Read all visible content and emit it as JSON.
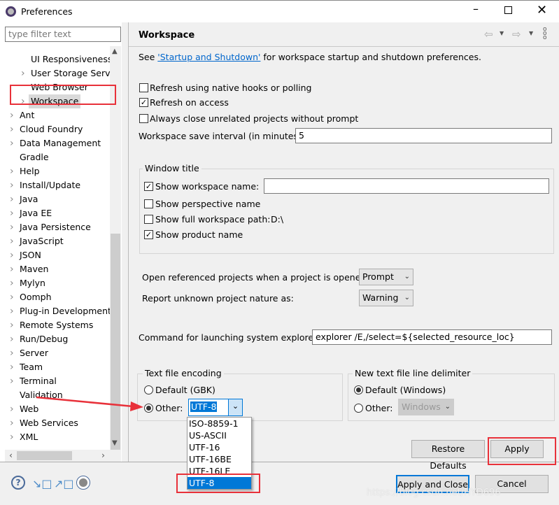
{
  "window": {
    "title": "Preferences"
  },
  "filter": {
    "placeholder": "type filter text"
  },
  "tree": [
    {
      "label": "UI Responsiveness",
      "level": 2,
      "expandable": false
    },
    {
      "label": "User Storage Servic",
      "level": 2,
      "expandable": true
    },
    {
      "label": "Web Browser",
      "level": 2,
      "expandable": false
    },
    {
      "label": "Workspace",
      "level": 2,
      "expandable": true,
      "selected": true
    },
    {
      "label": "Ant",
      "level": 1,
      "expandable": true
    },
    {
      "label": "Cloud Foundry",
      "level": 1,
      "expandable": true
    },
    {
      "label": "Data Management",
      "level": 1,
      "expandable": true
    },
    {
      "label": "Gradle",
      "level": 1,
      "expandable": false
    },
    {
      "label": "Help",
      "level": 1,
      "expandable": true
    },
    {
      "label": "Install/Update",
      "level": 1,
      "expandable": true
    },
    {
      "label": "Java",
      "level": 1,
      "expandable": true
    },
    {
      "label": "Java EE",
      "level": 1,
      "expandable": true
    },
    {
      "label": "Java Persistence",
      "level": 1,
      "expandable": true
    },
    {
      "label": "JavaScript",
      "level": 1,
      "expandable": true
    },
    {
      "label": "JSON",
      "level": 1,
      "expandable": true
    },
    {
      "label": "Maven",
      "level": 1,
      "expandable": true
    },
    {
      "label": "Mylyn",
      "level": 1,
      "expandable": true
    },
    {
      "label": "Oomph",
      "level": 1,
      "expandable": true
    },
    {
      "label": "Plug-in Development",
      "level": 1,
      "expandable": true
    },
    {
      "label": "Remote Systems",
      "level": 1,
      "expandable": true
    },
    {
      "label": "Run/Debug",
      "level": 1,
      "expandable": true
    },
    {
      "label": "Server",
      "level": 1,
      "expandable": true
    },
    {
      "label": "Team",
      "level": 1,
      "expandable": true
    },
    {
      "label": "Terminal",
      "level": 1,
      "expandable": true
    },
    {
      "label": "Validation",
      "level": 1,
      "expandable": false
    },
    {
      "label": "Web",
      "level": 1,
      "expandable": true
    },
    {
      "label": "Web Services",
      "level": 1,
      "expandable": true
    },
    {
      "label": "XML",
      "level": 1,
      "expandable": true
    }
  ],
  "page": {
    "title": "Workspace",
    "see_prefix": "See ",
    "see_link": "'Startup and Shutdown'",
    "see_suffix": " for workspace startup and shutdown preferences.",
    "refresh_native": {
      "label": "Refresh using native hooks or polling",
      "checked": false
    },
    "refresh_access": {
      "label": "Refresh on access",
      "checked": true
    },
    "always_close": {
      "label": "Always close unrelated projects without prompt",
      "checked": false
    },
    "save_interval": {
      "label": "Workspace save interval (in minutes):",
      "value": "5"
    },
    "window_title": {
      "group": "Window title",
      "show_ws_name": {
        "label": "Show workspace name:",
        "checked": true,
        "value": ""
      },
      "show_perspective": {
        "label": "Show perspective name",
        "checked": false
      },
      "show_full_path": {
        "label": "Show full workspace path:",
        "checked": false,
        "value": "D:\\"
      },
      "show_product": {
        "label": "Show product name",
        "checked": true
      }
    },
    "open_ref": {
      "label": "Open referenced projects when a project is opened:",
      "value": "Prompt"
    },
    "report_unknown": {
      "label": "Report unknown project nature as:",
      "value": "Warning"
    },
    "explorer_cmd": {
      "label": "Command for launching system explorer:",
      "value": "explorer /E,/select=${selected_resource_loc}"
    },
    "encoding": {
      "group": "Text file encoding",
      "default_label": "Default (GBK)",
      "other_label": "Other:",
      "value": "UTF-8",
      "options": [
        "ISO-8859-1",
        "US-ASCII",
        "UTF-16",
        "UTF-16BE",
        "UTF-16LE",
        "UTF-8"
      ],
      "highlighted": "UTF-8"
    },
    "delimiter": {
      "group": "New text file line delimiter",
      "default_label": "Default (Windows)",
      "other_label": "Other:",
      "value": "Windows"
    },
    "restore_defaults": "Restore Defaults",
    "apply": "Apply"
  },
  "footer": {
    "apply_close": "Apply and Close",
    "cancel": "Cancel"
  },
  "watermark": "https://blog.csdn.net/HYD696",
  "colors": {
    "accent": "#0078d7",
    "annotation": "#e8313a",
    "link": "#0066cc"
  }
}
